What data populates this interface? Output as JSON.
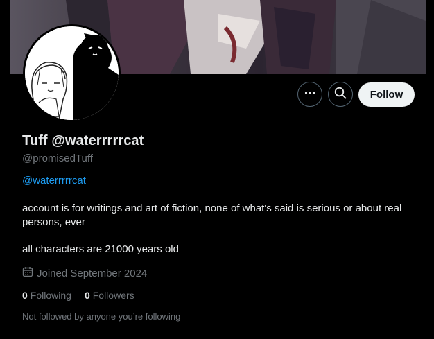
{
  "profile": {
    "display_name": "Tuff @waterrrrrcat",
    "handle": "@promisedTuff",
    "link": "@waterrrrrcat",
    "bio_line1": "account is for writings and art of fiction, none of what's said is serious or about real persons, ever",
    "bio_line2": "all characters are 21000 years old",
    "joined": "Joined September 2024",
    "following_count": "0",
    "following_label": "Following",
    "followers_count": "0",
    "followers_label": "Followers",
    "not_followed": "Not followed by anyone you’re following"
  },
  "actions": {
    "more_icon": "more-icon",
    "search_icon": "search-icon",
    "follow_label": "Follow"
  },
  "colors": {
    "background": "#000000",
    "text": "#e7e9ea",
    "muted": "#71767b",
    "link": "#1d9bf0",
    "border": "#536471"
  }
}
